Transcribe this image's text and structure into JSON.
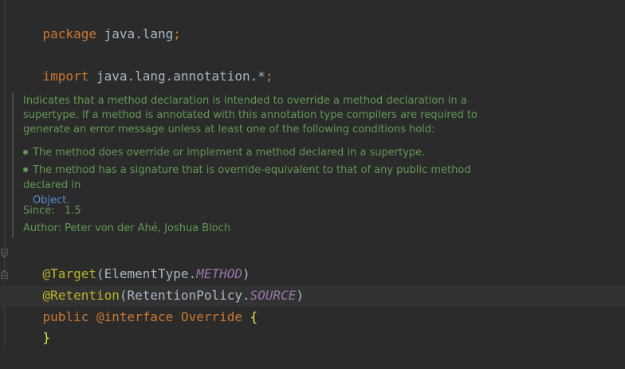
{
  "code": {
    "package_kw": "package",
    "package_name": " java.lang",
    "package_semi": ";",
    "import_kw": "import",
    "import_name": " java.lang.annotation.*",
    "import_semi": ";",
    "target_ann": "@Target",
    "target_open": "(ElementType.",
    "target_field": "METHOD",
    "target_close": ")",
    "retention_ann": "@Retention",
    "retention_open": "(RetentionPolicy.",
    "retention_field": "SOURCE",
    "retention_close": ")",
    "public_kw": "public",
    "interface_kw": " @interface",
    "class_name": " Override ",
    "open_brace": "{",
    "close_brace": "}"
  },
  "doc": {
    "intro": "Indicates that a method declaration is intended to override a method declaration in a supertype. If a method is annotated with this annotation type compilers are required to generate an error message unless at least one of the following conditions hold:",
    "bullet1": "The method does override or implement a method declared in a supertype.",
    "bullet2": "The method has a signature that is override-equivalent to that of any public method declared in",
    "bullet2_link": "Object",
    "bullet2_end": ".",
    "since_label": "Since:",
    "since_value": "1.5",
    "author": "Author: Peter von der Ahé, Joshua Bloch"
  },
  "colors": {
    "background": "#2b2b2b",
    "keyword": "#cc7832",
    "annotation": "#bbb529",
    "doc": "#629755",
    "field": "#9876aa",
    "link": "#5c8cc9"
  }
}
